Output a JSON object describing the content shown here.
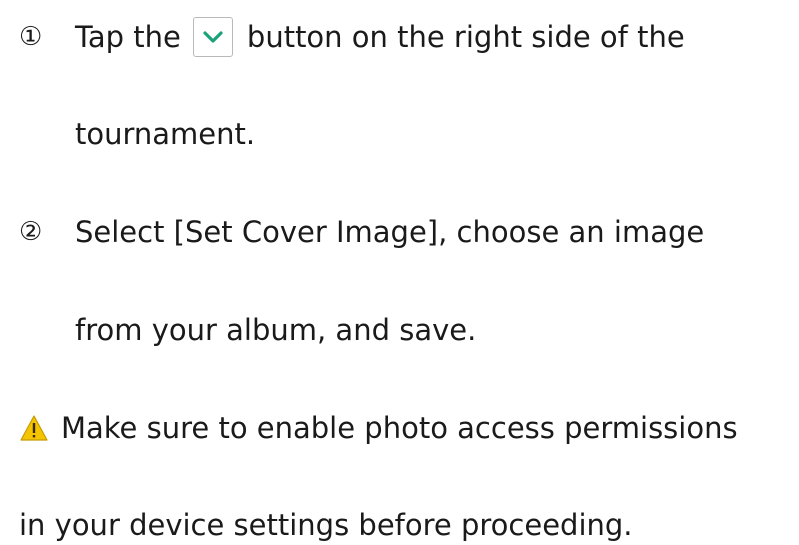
{
  "steps": [
    {
      "marker": "①",
      "before_button": "Tap the",
      "button_icon": "chevron-down-icon",
      "after_button": "button on the right side of the",
      "continuation": "tournament."
    },
    {
      "marker": "②",
      "text": "Select [Set Cover Image], choose an image",
      "continuation": "from your album, and save."
    }
  ],
  "warning": {
    "icon": "warning-triangle-icon",
    "line1": "Make sure to enable photo access permissions",
    "line2": "in your device settings before proceeding."
  },
  "colors": {
    "text": "#1a1a1a",
    "chevron": "#1aa37a",
    "warning_fill": "#f5c400"
  }
}
